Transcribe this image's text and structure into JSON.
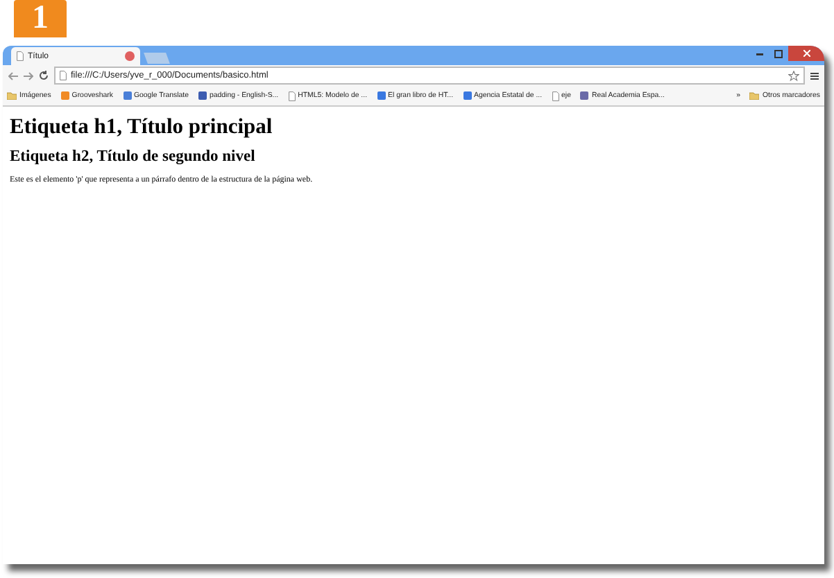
{
  "badge": "1",
  "tab": {
    "title": "Título",
    "selected": true
  },
  "address": "file:///C:/Users/yve_r_000/Documents/basico.html",
  "bookmarks": [
    {
      "kind": "folder",
      "label": "Imágenes"
    },
    {
      "kind": "site",
      "label": "Grooveshark",
      "color": "#f08a24"
    },
    {
      "kind": "site",
      "label": "Google Translate",
      "color": "#4a7fd8"
    },
    {
      "kind": "site",
      "label": "padding - English-S...",
      "color": "#3c5cb0"
    },
    {
      "kind": "page",
      "label": "HTML5: Modelo de ..."
    },
    {
      "kind": "site",
      "label": "El gran libro de HT...",
      "color": "#3a78e0"
    },
    {
      "kind": "site",
      "label": "Agencia Estatal de ...",
      "color": "#3a78e0"
    },
    {
      "kind": "page",
      "label": "eje"
    },
    {
      "kind": "site",
      "label": "Real Academia Espa...",
      "color": "#6a6aa8"
    }
  ],
  "overflow": "»",
  "other_bookmarks": "Otros marcadores",
  "h1": "Etiqueta h1, Título principal",
  "h2": "Etiqueta h2, Título de segundo nivel",
  "paragraph": "Este es el elemento 'p' que representa a un párrafo dentro de la estructura de la página web."
}
